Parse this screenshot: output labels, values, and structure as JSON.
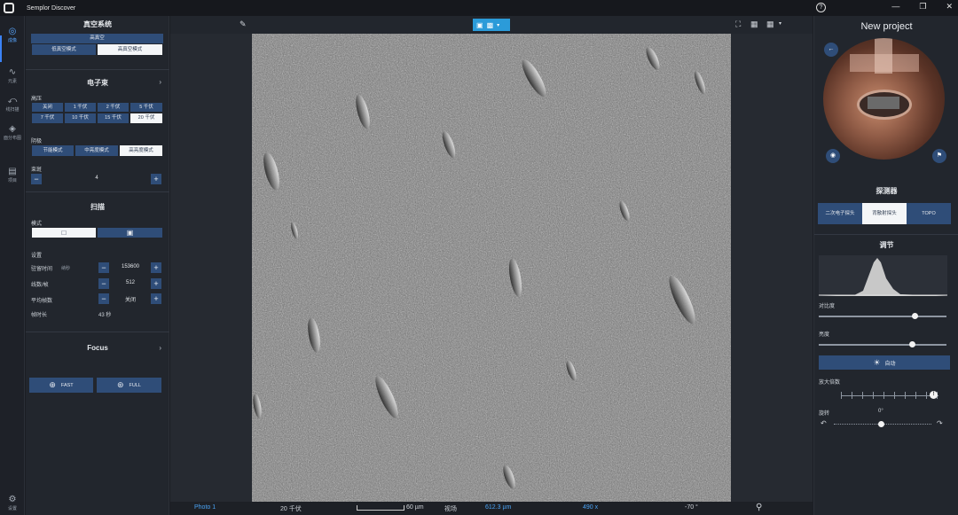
{
  "app": {
    "title": "Semplor Discover"
  },
  "rail": {
    "items": [
      {
        "label": "成像",
        "icon": "camera-icon"
      },
      {
        "label": "元素",
        "icon": "element-icon"
      },
      {
        "label": "线扫描",
        "icon": "line-scan-icon"
      },
      {
        "label": "面分布图",
        "icon": "layers-icon"
      },
      {
        "label": "项目",
        "icon": "document-icon"
      },
      {
        "label": "设置",
        "icon": "gear-icon"
      }
    ]
  },
  "vacuum": {
    "title": "真空系统",
    "status": "高真空",
    "modes": [
      "低真空模式",
      "高真空模式"
    ],
    "selected_mode": "高真空模式"
  },
  "beam": {
    "title": "电子束",
    "voltage_label": "高压",
    "voltages": [
      "关闭",
      "1 千伏",
      "2 千伏",
      "5 千伏",
      "7 千伏",
      "10 千伏",
      "15 千伏",
      "20 千伏"
    ],
    "selected_voltage": "20 千伏",
    "cathode_label": "阴极",
    "cathode_modes": [
      "节能模式",
      "中亮度模式",
      "高亮度模式"
    ],
    "selected_cathode": "高亮度模式",
    "spot_label": "束斑",
    "spot_value": "4"
  },
  "scan": {
    "title": "扫描",
    "mode_label": "模式",
    "settings_label": "设置",
    "dwell_label": "驻留时间",
    "dwell_unit": "纳秒",
    "dwell_value": "153600",
    "lines_label": "线数/帧",
    "lines_value": "512",
    "avg_label": "平均帧数",
    "avg_value": "关闭",
    "frame_time_label": "帧时长",
    "frame_time_value": "43 秒"
  },
  "focus": {
    "title": "Focus",
    "fast_label": "FAST",
    "full_label": "FULL"
  },
  "status": {
    "photo": "Photo 1",
    "voltage": "20 千伏",
    "scale": "60 µm",
    "field_label": "视场",
    "field_value": "612.3 µm",
    "magnification": "490 x",
    "rotation": "-70 °"
  },
  "right": {
    "project_title": "New project",
    "detector_title": "探测器",
    "detectors": [
      "二次电子探头",
      "背散射探头",
      "TOPO"
    ],
    "selected_detector": "背散射探头",
    "adjust_title": "调节",
    "contrast_label": "对比度",
    "contrast_level": 0.75,
    "brightness_label": "亮度",
    "brightness_level": 0.73,
    "auto_label": "自动",
    "mag_label": "放大倍数",
    "rotation_label": "旋转",
    "rotation_value": "0°"
  },
  "colors": {
    "accent": "#2f4d78",
    "highlight": "#2b9bd9",
    "link": "#4aa3f5"
  }
}
